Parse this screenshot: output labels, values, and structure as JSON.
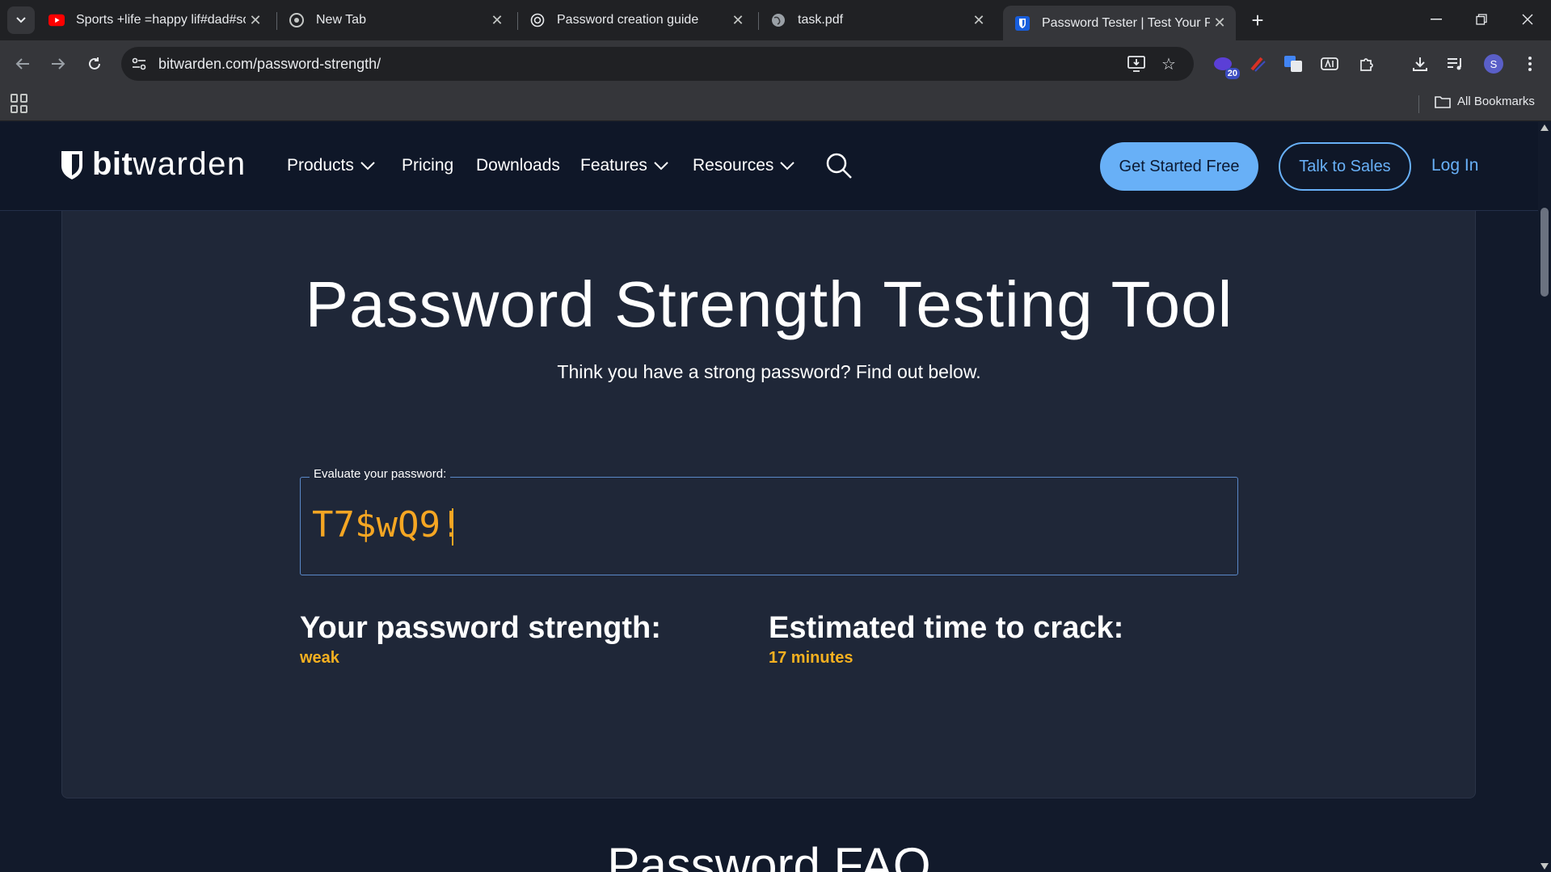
{
  "browser": {
    "tabs": [
      {
        "title": "Sports +life =happy lif#dad#so",
        "favicon": "youtube-icon",
        "active": false
      },
      {
        "title": "New Tab",
        "favicon": "chrome-icon",
        "active": false
      },
      {
        "title": "Password creation guide",
        "favicon": "openai-icon",
        "active": false
      },
      {
        "title": "task.pdf",
        "favicon": "globe-icon",
        "active": false
      },
      {
        "title": "Password Tester | Test Your Pass",
        "favicon": "bitwarden-icon",
        "active": true
      }
    ],
    "url": "bitwarden.com/password-strength/",
    "extension_badge": "20",
    "profile_initial": "S",
    "all_bookmarks_label": "All Bookmarks"
  },
  "site": {
    "logo_bold": "bit",
    "logo_light": "warden",
    "nav": [
      {
        "label": "Products",
        "has_dropdown": true
      },
      {
        "label": "Pricing",
        "has_dropdown": false
      },
      {
        "label": "Downloads",
        "has_dropdown": false
      },
      {
        "label": "Features",
        "has_dropdown": true
      },
      {
        "label": "Resources",
        "has_dropdown": true
      }
    ],
    "cta_primary": "Get Started Free",
    "cta_secondary": "Talk to Sales",
    "login": "Log In"
  },
  "main": {
    "title": "Password Strength Testing Tool",
    "subtitle": "Think you have a strong password? Find out below.",
    "password_field": {
      "label": "Evaluate your password:",
      "value": "T7$wQ9!"
    },
    "strength": {
      "heading": "Your password strength:",
      "value": "weak"
    },
    "crack_time": {
      "heading": "Estimated time to crack:",
      "value": "17 minutes"
    },
    "faq_title": "Password FAQ"
  },
  "colors": {
    "accent_blue": "#68b0f7",
    "warning_orange": "#f5b020",
    "page_bg": "#121a2b",
    "card_bg": "#1f2738"
  }
}
